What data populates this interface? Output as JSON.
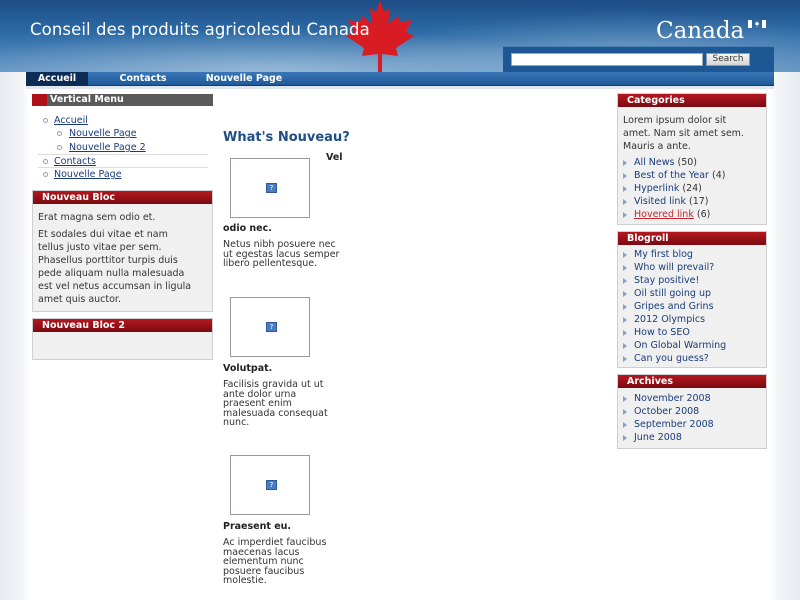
{
  "header": {
    "site_title": "Conseil des produits agricolesdu Canada",
    "wordmark": "Canada",
    "search_placeholder": "",
    "search_button": "Search"
  },
  "nav": {
    "items": [
      {
        "label": "Accueil",
        "active": true
      },
      {
        "label": "Contacts",
        "active": false
      },
      {
        "label": "Nouvelle Page",
        "active": false
      }
    ]
  },
  "vertical_menu": {
    "title": "Vertical Menu",
    "items": [
      {
        "label": "Accueil",
        "level": 0
      },
      {
        "label": "Nouvelle Page",
        "level": 1
      },
      {
        "label": "Nouvelle Page 2",
        "level": 1
      },
      {
        "label": "Contacts",
        "level": 0
      },
      {
        "label": "Nouvelle Page",
        "level": 0
      }
    ]
  },
  "nouveau_bloc": {
    "title": "Nouveau Bloc",
    "para1": "Erat magna sem odio et.",
    "para2_lines": [
      "Et sodales dui vitae et nam",
      "tellus justo vitae per sem.",
      "Phasellus porttitor turpis duis",
      "pede aliquam nulla malesuada",
      "est vel netus accumsan in ligula",
      "amet quis auctor."
    ]
  },
  "nouveau_bloc_2": {
    "title": "Nouveau Bloc 2"
  },
  "main": {
    "title": "What's Nouveau?",
    "vel": "Vel",
    "articles": [
      {
        "title": "odio nec.",
        "lines": [
          "Netus nibh posuere nec",
          "ut egestas lacus semper",
          "libero pellentesque."
        ]
      },
      {
        "title": "Volutpat.",
        "lines": [
          "Facilisis gravida ut ut",
          "ante dolor urna",
          "praesent enim",
          "malesuada consequat",
          "nunc."
        ]
      },
      {
        "title": "Praesent eu.",
        "lines": [
          "Ac imperdiet faucibus",
          "maecenas lacus",
          "elementum nunc",
          "posuere faucibus",
          "molestie."
        ]
      }
    ]
  },
  "categories": {
    "title": "Categories",
    "intro_lines": [
      "Lorem ipsum dolor sit",
      "amet. Nam sit amet sem.",
      "Mauris a ante."
    ],
    "items": [
      {
        "label": "All News",
        "count": "(50)"
      },
      {
        "label": "Best of the Year",
        "count": "(4)"
      },
      {
        "label": "Hyperlink",
        "count": "(24)"
      },
      {
        "label": "Visited link",
        "count": "(17)"
      },
      {
        "label": "Hovered link",
        "count": "(6)"
      }
    ]
  },
  "blogroll": {
    "title": "Blogroll",
    "items": [
      "My first blog",
      "Who will prevail?",
      "Stay positive!",
      "Oil still going up",
      "Gripes and Grins",
      "2012 Olympics",
      "How to SEO",
      "On Global Warming",
      "Can you guess?"
    ]
  },
  "archives": {
    "title": "Archives",
    "items": [
      "November 2008",
      "October 2008",
      "September 2008",
      "June 2008"
    ]
  },
  "colors": {
    "header_blue": "#1d4c84",
    "block_red": "#b51820",
    "link_blue": "#1a3c7a",
    "hover_red": "#c0282e"
  }
}
